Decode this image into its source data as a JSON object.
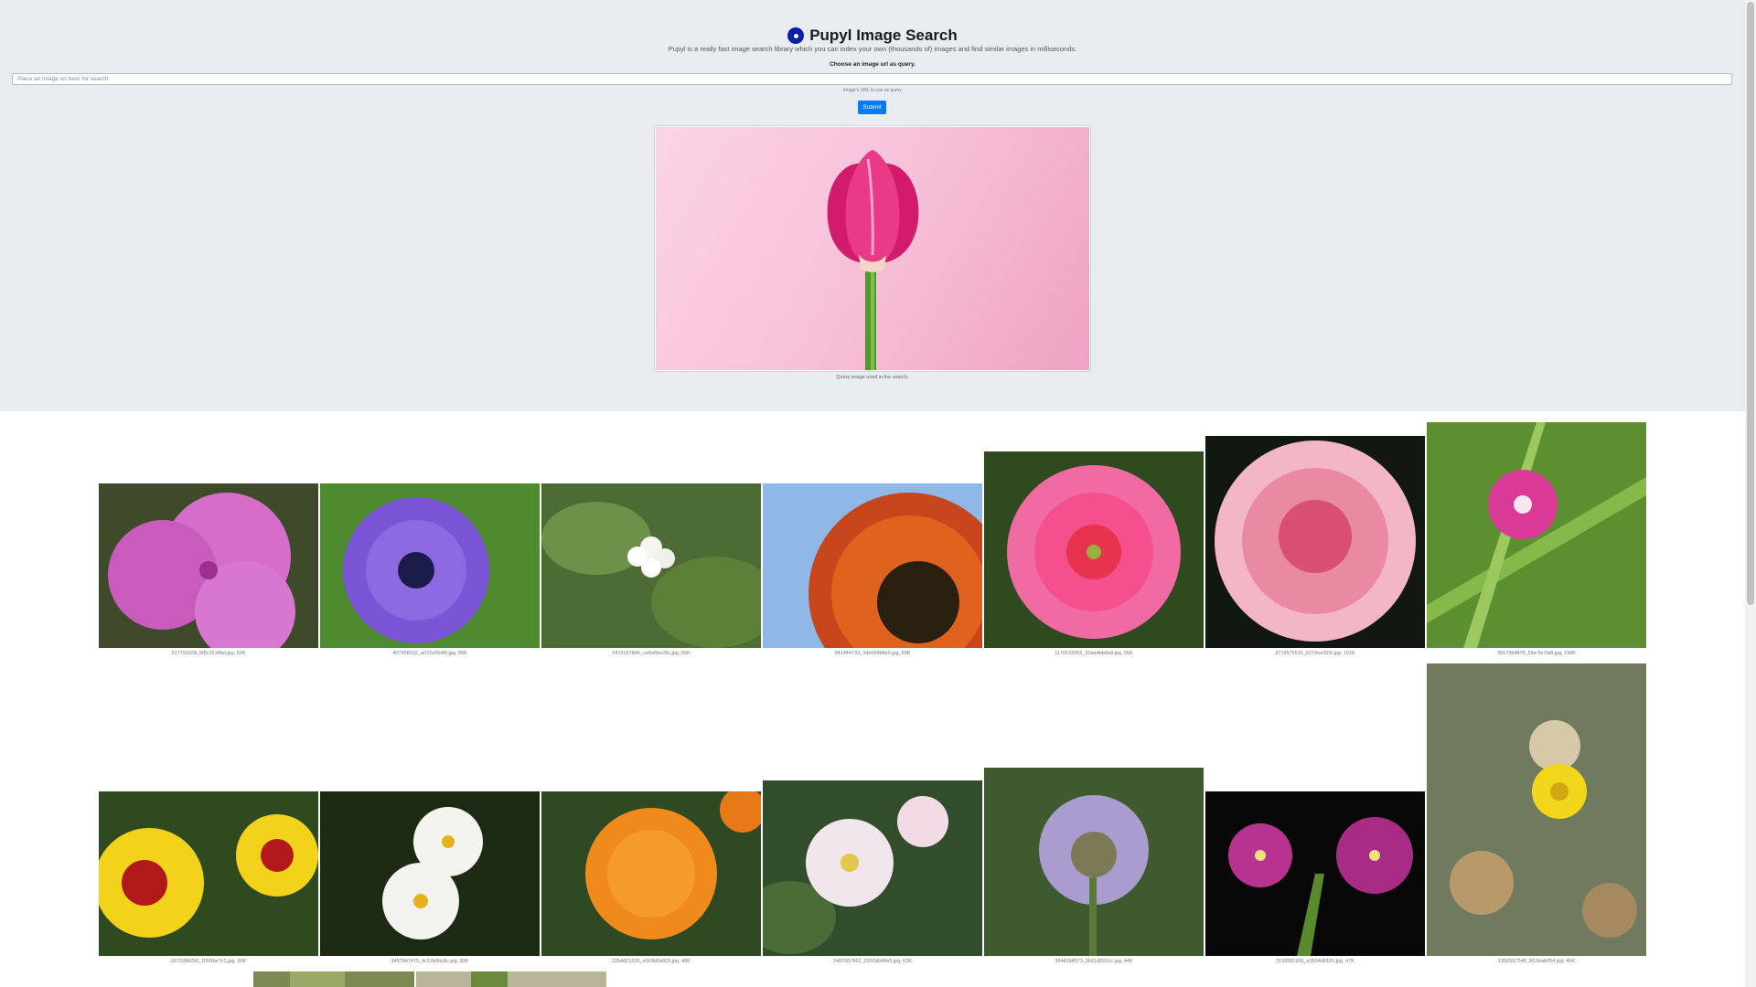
{
  "header": {
    "title": "Pupyl Image Search",
    "tagline": "Pupyl is a really fast image search library which you can index your own (thousands of) images and find similar images in milliseconds.",
    "choose_label": "Choose an image url as query.",
    "search_placeholder": "Place an image url here for search.",
    "help_text": "Image's URL to use as query",
    "submit_label": "Submit"
  },
  "query": {
    "caption": "Query image used in the search."
  },
  "results": [
    {
      "caption": "517791628_5f8c1518bd.jpg, 52K"
    },
    {
      "caption": "407958022_a072a55df9.jpg, 85K"
    },
    {
      "caption": "2415157846_ce0a5be28c.jpg, 56K"
    },
    {
      "caption": "941444733_3de664b8e0.jpg, 80K"
    },
    {
      "caption": "1178122002_20aa4bb8a9.jpg, 55K"
    },
    {
      "caption": "2719575531_5272ee359f.jpg, 101K"
    },
    {
      "caption": "3557394878_55e7fe1fa8.jpg, 138K"
    },
    {
      "caption": "2673396250_f151fbe7c1.jpg, 66K"
    },
    {
      "caption": "3497847475_4c12b6bc8c.jpg, 82K"
    },
    {
      "caption": "2254821336_e603d0a815.jpg, 48K"
    },
    {
      "caption": "2497057862_3151d048e5.jpg, 63K"
    },
    {
      "caption": "3644194573_2b61d291cc.jpg, 44K"
    },
    {
      "caption": "3193581355_e3504d8181.jpg, 47K"
    },
    {
      "caption": "1350597248_9f11bab254.jpg, 45K"
    }
  ],
  "colors": {
    "hero_bg": "#e9ecef",
    "submit_bg": "#007bff",
    "logo": "#0b1fa8"
  }
}
